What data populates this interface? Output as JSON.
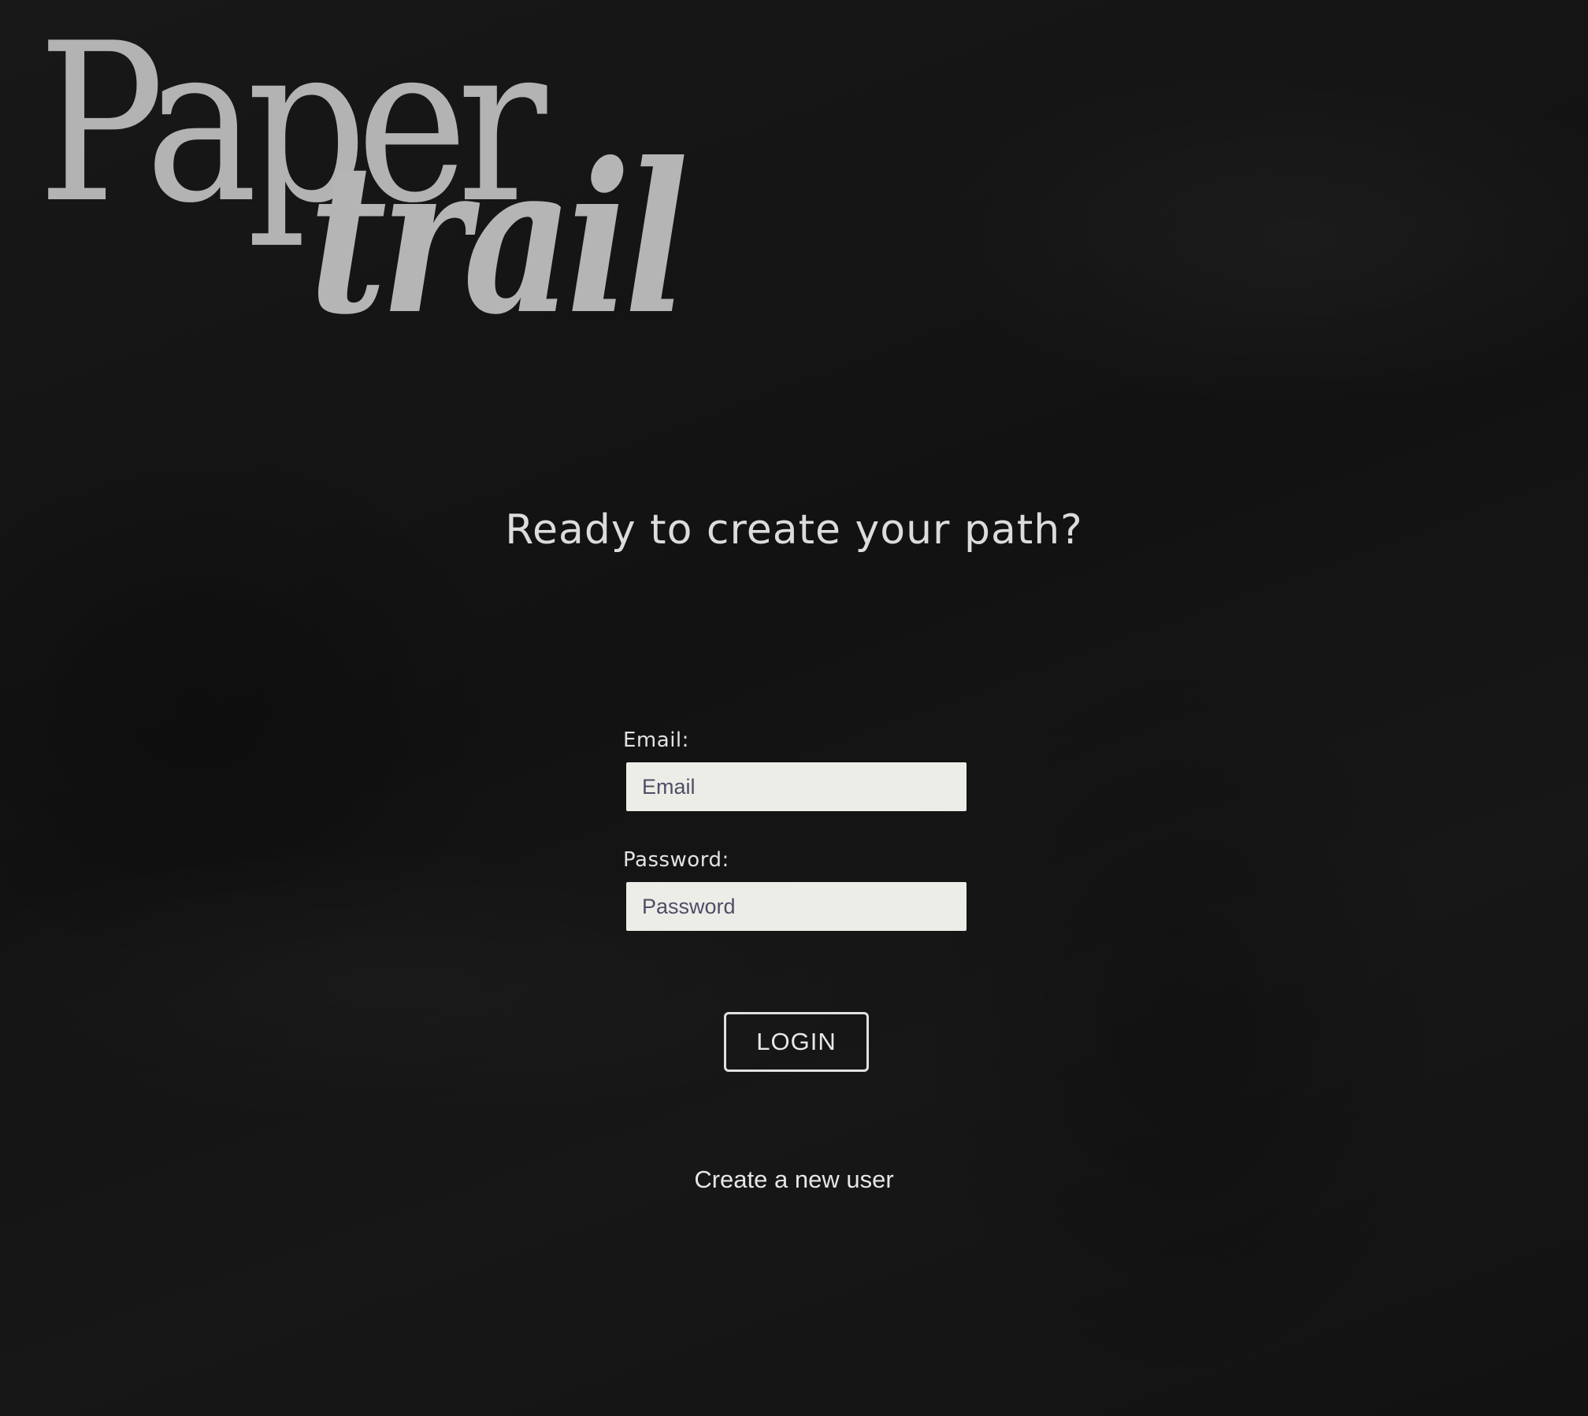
{
  "logo": {
    "line1": "Paper",
    "line2": "trail"
  },
  "heading": "Ready to create your path?",
  "form": {
    "email": {
      "label": "Email:",
      "placeholder": "Email",
      "value": ""
    },
    "password": {
      "label": "Password:",
      "placeholder": "Password",
      "value": ""
    },
    "login_label": "LOGIN"
  },
  "links": {
    "create_user": "Create a new user"
  },
  "colors": {
    "background": "#141414",
    "logo": "#b3b3b3",
    "input_background": "#edede8",
    "text": "#e2e2e2"
  }
}
